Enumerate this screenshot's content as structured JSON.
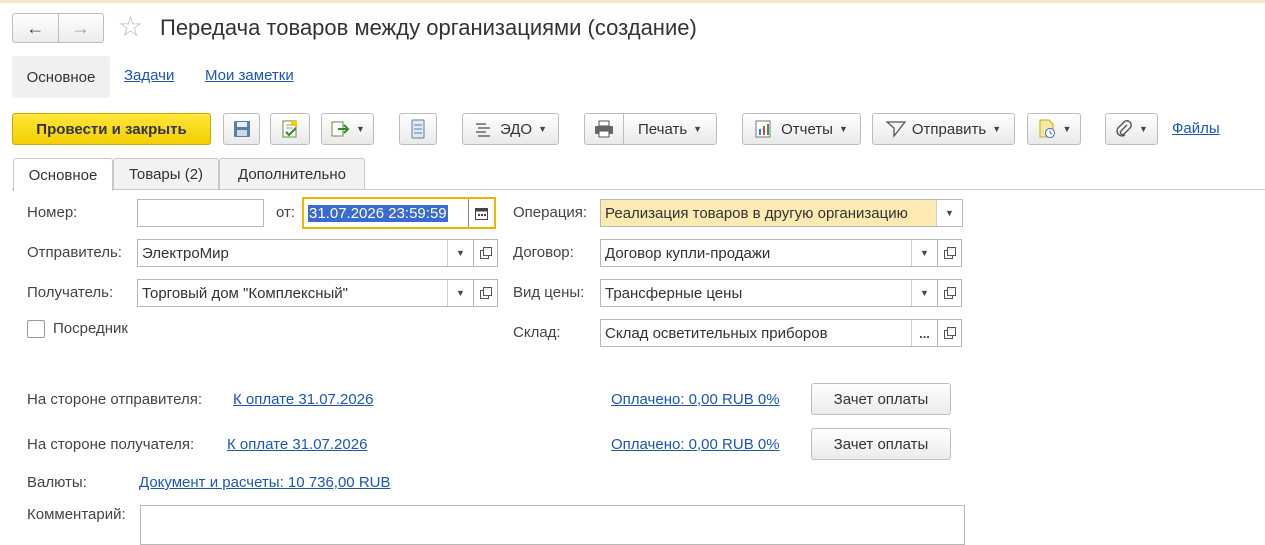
{
  "window": {
    "title": "Передача товаров между организациями (создание)"
  },
  "nav": {
    "back": "←",
    "forward": "→",
    "star": "☆"
  },
  "top_tabs": {
    "main": "Основное",
    "tasks": "Задачи",
    "notes": "Мои заметки"
  },
  "toolbar": {
    "post_close": "Провести и закрыть",
    "edo": "ЭДО",
    "print": "Печать",
    "reports": "Отчеты",
    "send": "Отправить",
    "files": "Файлы"
  },
  "form_tabs": {
    "main": "Основное",
    "goods": "Товары (2)",
    "additional": "Дополнительно"
  },
  "form": {
    "number_label": "Номер:",
    "number_value": "",
    "from_label": "от:",
    "date_value": "31.07.2026 23:59:59",
    "operation_label": "Операция:",
    "operation_value": "Реализация товаров в другую организацию",
    "sender_label": "Отправитель:",
    "sender_value": "ЭлектроМир",
    "contract_label": "Договор:",
    "contract_value": "Договор купли-продажи",
    "receiver_label": "Получатель:",
    "receiver_value": "Торговый дом \"Комплексный\"",
    "price_type_label": "Вид цены:",
    "price_type_value": "Трансферные цены",
    "intermediary_label": "Посредник",
    "warehouse_label": "Склад:",
    "warehouse_value": "Склад осветительных приборов"
  },
  "payments": {
    "sender_side_label": "На стороне отправителя:",
    "sender_due_link": "К оплате 31.07.2026",
    "sender_paid_link": "Оплачено: 0,00 RUB 0%",
    "receiver_side_label": "На стороне получателя:",
    "receiver_due_link": "К оплате 31.07.2026",
    "receiver_paid_link": "Оплачено: 0,00 RUB 0%",
    "offset_button": "Зачет оплаты"
  },
  "currency": {
    "label": "Валюты:",
    "link": "Документ и расчеты: 10 736,00 RUB"
  },
  "comment": {
    "label": "Комментарий:",
    "value": ""
  },
  "colors": {
    "primary_button": "#f2cf00",
    "link": "#1a56b8",
    "operation_highlight": "#fde9b2",
    "date_focus_border": "#f0b400",
    "date_selection": "#3a6bd0"
  }
}
